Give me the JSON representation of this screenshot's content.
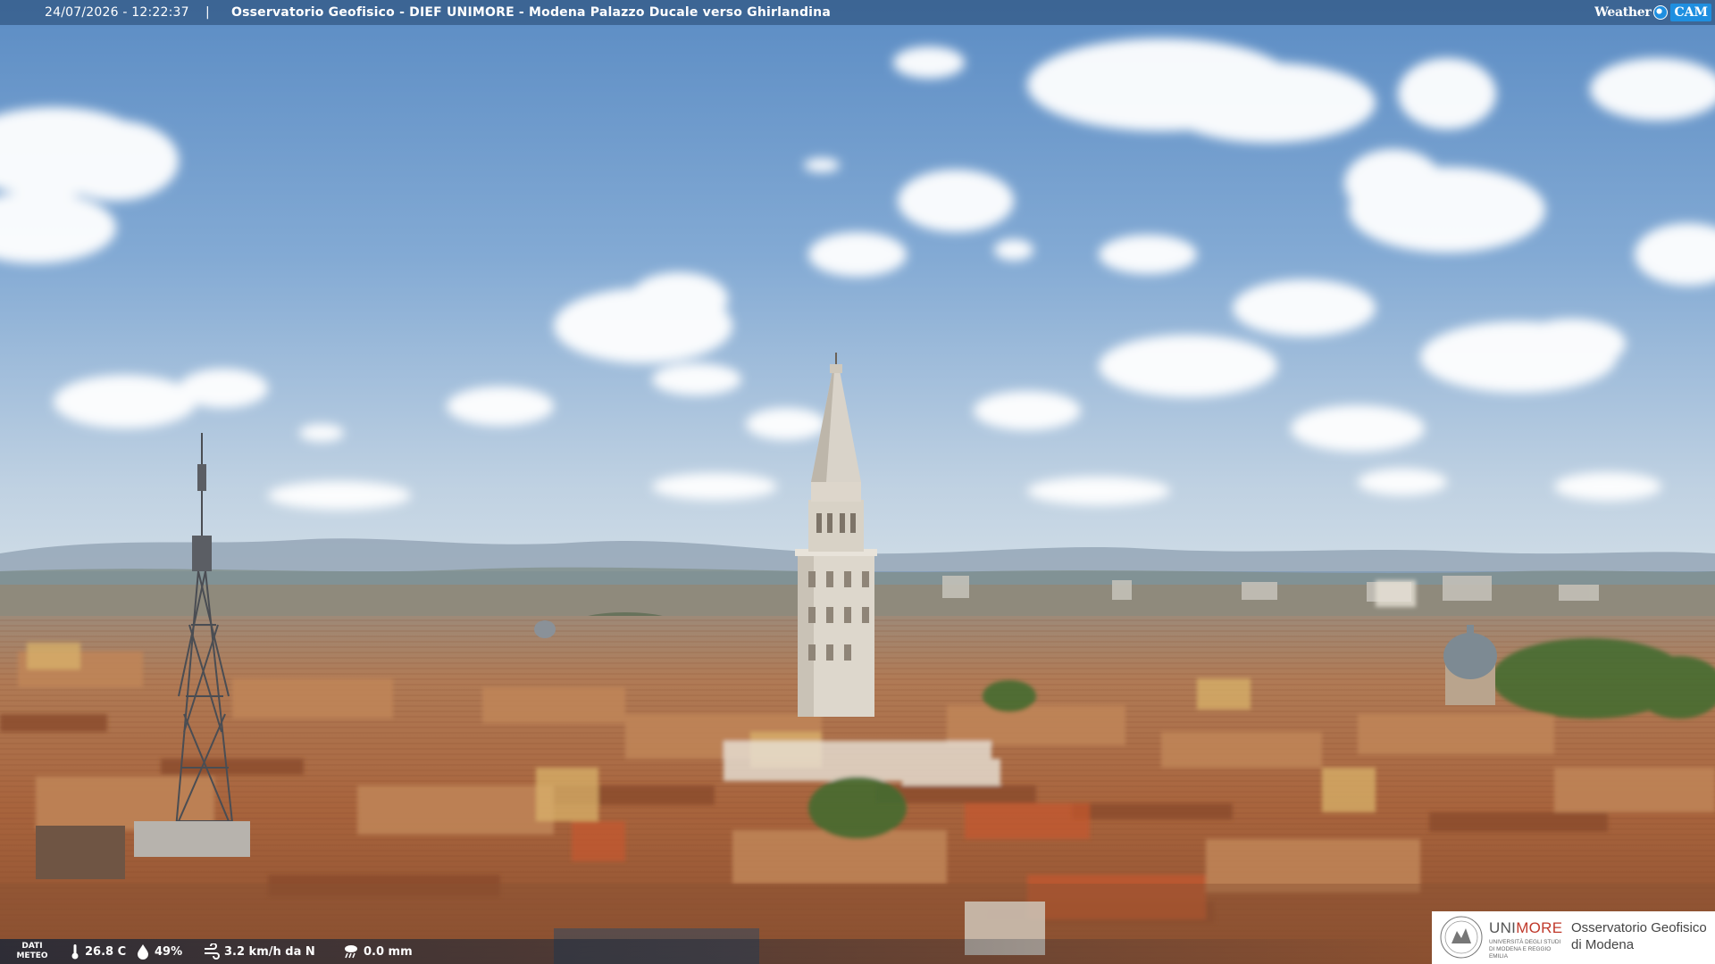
{
  "webcam": {
    "timestamp": "24/07/2026 - 12:22:37",
    "separator": "|",
    "title": "Osservatorio Geofisico - DIEF UNIMORE - Modena Palazzo Ducale verso Ghirlandina"
  },
  "branding": {
    "weather_text": "Weather",
    "cam_text": "CAM",
    "icon": "weather-globe-icon"
  },
  "meteo": {
    "label_line1": "DATI",
    "label_line2": "METEO",
    "temperature": {
      "icon": "thermometer-icon",
      "value": "26.8 C"
    },
    "humidity": {
      "icon": "humidity-drop-icon",
      "value": "49%"
    },
    "wind": {
      "icon": "wind-icon",
      "value": "3.2 km/h da N"
    },
    "rain": {
      "icon": "rain-cloud-icon",
      "value": "0.0 mm"
    }
  },
  "logo": {
    "uni_prefix": "UNI",
    "uni_suffix": "MORE",
    "uni_subtitle": "UNIVERSITÀ DEGLI STUDI DI MODENA E REGGIO EMILIA",
    "observatory_line1": "Osservatorio Geofisico",
    "observatory_line2": "di Modena",
    "seal_icon": "university-seal-icon",
    "accent_color": "#c0392b"
  },
  "palette": {
    "sky_top": "#5f8fc6",
    "sky_bottom": "#c9d9e6",
    "roof_terracotta": "#b8734a",
    "tower_stone": "#dcd6cb"
  }
}
